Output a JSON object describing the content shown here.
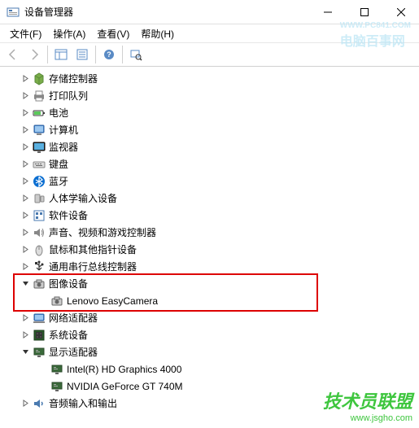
{
  "window": {
    "title": "设备管理器"
  },
  "menu": {
    "file": "文件(F)",
    "action": "操作(A)",
    "view": "查看(V)",
    "help": "帮助(H)"
  },
  "tree": {
    "items": [
      {
        "label": "存储控制器",
        "icon": "storage",
        "level": 1,
        "expand": "closed"
      },
      {
        "label": "打印队列",
        "icon": "printer",
        "level": 1,
        "expand": "closed"
      },
      {
        "label": "电池",
        "icon": "battery",
        "level": 1,
        "expand": "closed"
      },
      {
        "label": "计算机",
        "icon": "computer",
        "level": 1,
        "expand": "closed"
      },
      {
        "label": "监视器",
        "icon": "monitor",
        "level": 1,
        "expand": "closed"
      },
      {
        "label": "键盘",
        "icon": "keyboard",
        "level": 1,
        "expand": "closed"
      },
      {
        "label": "蓝牙",
        "icon": "bluetooth",
        "level": 1,
        "expand": "closed"
      },
      {
        "label": "人体学输入设备",
        "icon": "hid",
        "level": 1,
        "expand": "closed"
      },
      {
        "label": "软件设备",
        "icon": "software",
        "level": 1,
        "expand": "closed"
      },
      {
        "label": "声音、视频和游戏控制器",
        "icon": "sound",
        "level": 1,
        "expand": "closed"
      },
      {
        "label": "鼠标和其他指针设备",
        "icon": "mouse",
        "level": 1,
        "expand": "closed"
      },
      {
        "label": "通用串行总线控制器",
        "icon": "usb",
        "level": 1,
        "expand": "closed"
      },
      {
        "label": "图像设备",
        "icon": "camera",
        "level": 1,
        "expand": "open",
        "highlighted": true
      },
      {
        "label": "Lenovo EasyCamera",
        "icon": "camera",
        "level": 2,
        "expand": "none",
        "highlighted": true
      },
      {
        "label": "网络适配器",
        "icon": "network",
        "level": 1,
        "expand": "closed"
      },
      {
        "label": "系统设备",
        "icon": "system",
        "level": 1,
        "expand": "closed"
      },
      {
        "label": "显示适配器",
        "icon": "display",
        "level": 1,
        "expand": "open"
      },
      {
        "label": "Intel(R) HD Graphics 4000",
        "icon": "display",
        "level": 2,
        "expand": "none"
      },
      {
        "label": "NVIDIA GeForce GT 740M",
        "icon": "display",
        "level": 2,
        "expand": "none"
      },
      {
        "label": "音频输入和输出",
        "icon": "audio",
        "level": 1,
        "expand": "closed"
      }
    ]
  },
  "watermark": {
    "top_url": "WWW.PC841.COM",
    "top_text": "电脑百事网",
    "bottom_text": "技术员联盟",
    "bottom_url": "www.jsgho.com"
  }
}
